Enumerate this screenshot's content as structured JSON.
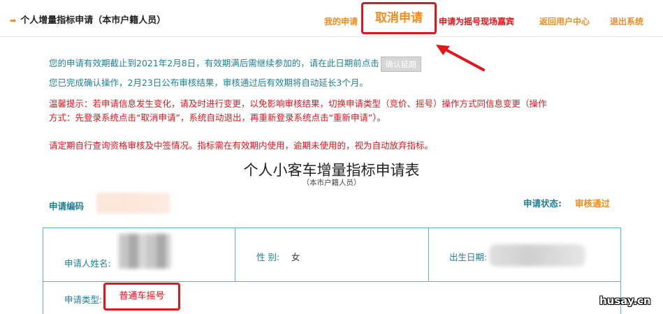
{
  "header": {
    "title": "个人增量指标申请（本市户籍人员）",
    "nav": {
      "my_application": "我的申请",
      "cancel_application": "取消申请",
      "apply_guest": "申请为摇号现场嘉宾",
      "back_user_center": "返回用户中心",
      "logout": "退出系统"
    }
  },
  "notices": {
    "validity_text": "您的申请有效期截止到2021年2月8日，有效期满后需继续参加的，请在此日期前点击",
    "confirm_extend_button": "确认延期",
    "confirm_done": "您已完成确认操作，2月23日公布审核结果，审核通过后有效期将自动延长3个月。",
    "tip_line1": "温馨提示：若申请信息发生变化，请及时进行变更，以免影响审核结果，切换申请类型（竞价、摇号）操作方式同信息变更（操作",
    "tip_line2": "方式：先登录系统点击“取消申请”，系统自动退出，再重新登录系统点击“重新申请”）。",
    "periodic_check": "请定期自行查询资格审核及中签情况。指标需在有效期内使用，逾期未使用的，视为自动放弃指标。"
  },
  "form": {
    "title": "个人小客车增量指标申请表",
    "subtitle": "（本市户籍人员）",
    "code_label": "申请编码",
    "status_label": "申请状态:",
    "status_value": "审核通过",
    "name_label": "申请人姓名:",
    "gender_label": "性 别:",
    "gender_value": "女",
    "dob_label": "出生日期:",
    "type_label": "申请类型:",
    "type_value": "普通车摇号"
  },
  "watermark": "husay.cn",
  "colors": {
    "accent_orange": "#f08c1e",
    "highlight_red": "#e3141c",
    "text_teal": "#1e7f96",
    "table_border": "#5eb2c9"
  }
}
